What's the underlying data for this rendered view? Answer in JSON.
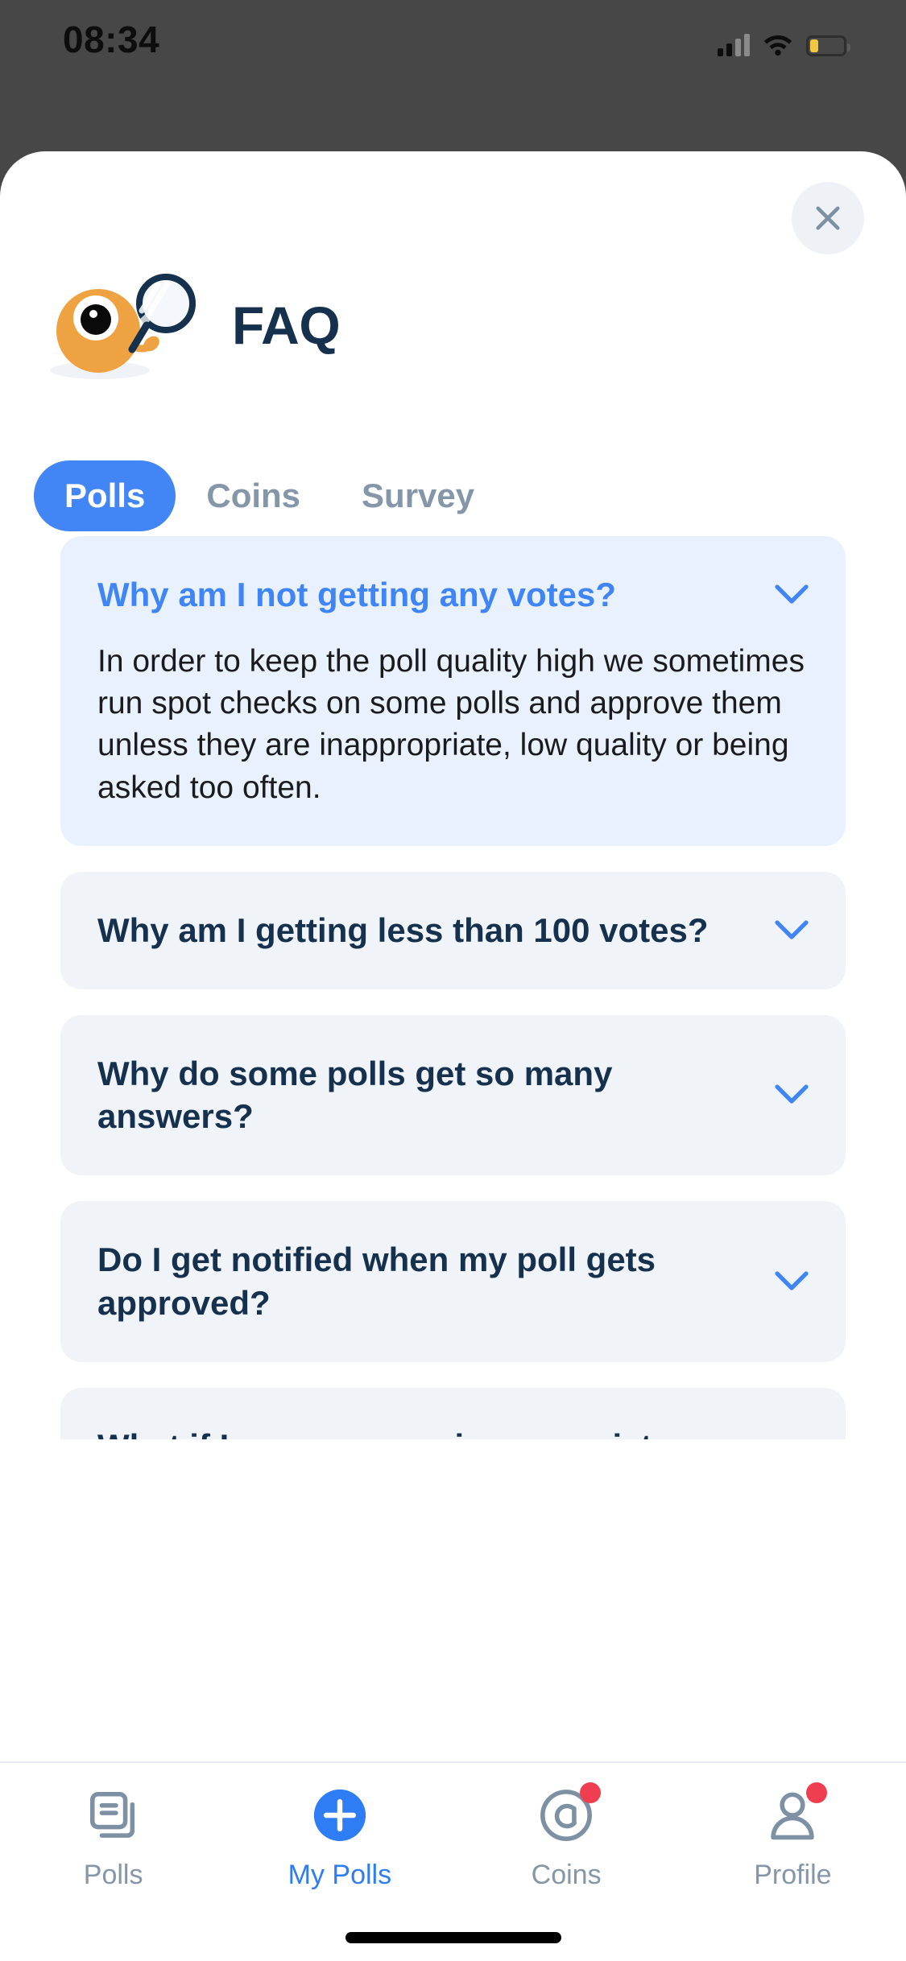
{
  "status_bar": {
    "time": "08:34",
    "icons": {
      "signal": "cellular-signal-icon",
      "wifi": "wifi-icon",
      "battery": "battery-low-icon"
    },
    "battery_color": "#f2c744"
  },
  "sheet": {
    "close_icon": "close-icon",
    "mascot_icon": "mascot-magnifier-icon",
    "title": "FAQ"
  },
  "tabs": [
    {
      "label": "Polls",
      "active": true
    },
    {
      "label": "Coins",
      "active": false
    },
    {
      "label": "Survey",
      "active": false
    }
  ],
  "faq": [
    {
      "question": "Why am I not getting any votes?",
      "answer": "In order to keep the poll quality high we sometimes run spot checks on some polls and approve them unless they are inappropriate, low quality or being asked too often.",
      "expanded": true,
      "chevron_icon": "chevron-down-icon"
    },
    {
      "question": "Why am I getting less than 100 votes?",
      "answer": "",
      "expanded": false,
      "chevron_icon": "chevron-down-icon"
    },
    {
      "question": "Why do some polls get so many answers?",
      "answer": "",
      "expanded": false,
      "chevron_icon": "chevron-down-icon"
    },
    {
      "question": "Do I get notified when my poll gets approved?",
      "answer": "",
      "expanded": false,
      "chevron_icon": "chevron-down-icon"
    },
    {
      "question": "What if I come across inappropriate content?",
      "answer": "",
      "expanded": false,
      "chevron_icon": "chevron-down-icon"
    }
  ],
  "bottom_nav": [
    {
      "label": "Polls",
      "icon": "documents-stack-icon",
      "active": false,
      "badge": false
    },
    {
      "label": "My Polls",
      "icon": "plus-circle-icon",
      "active": true,
      "badge": false
    },
    {
      "label": "Coins",
      "icon": "coin-icon",
      "active": false,
      "badge": true
    },
    {
      "label": "Profile",
      "icon": "person-icon",
      "active": false,
      "badge": true
    }
  ],
  "colors": {
    "accent_blue": "#4285f4",
    "question_navy": "#16314d",
    "open_card_bg": "#e8f1fd",
    "card_bg": "#f0f3f8",
    "muted_text": "#8496a8",
    "badge_red": "#ef3e4f",
    "mascot_orange": "#efa242",
    "overlay_gray": "#474747"
  },
  "home_indicator": "home-indicator"
}
